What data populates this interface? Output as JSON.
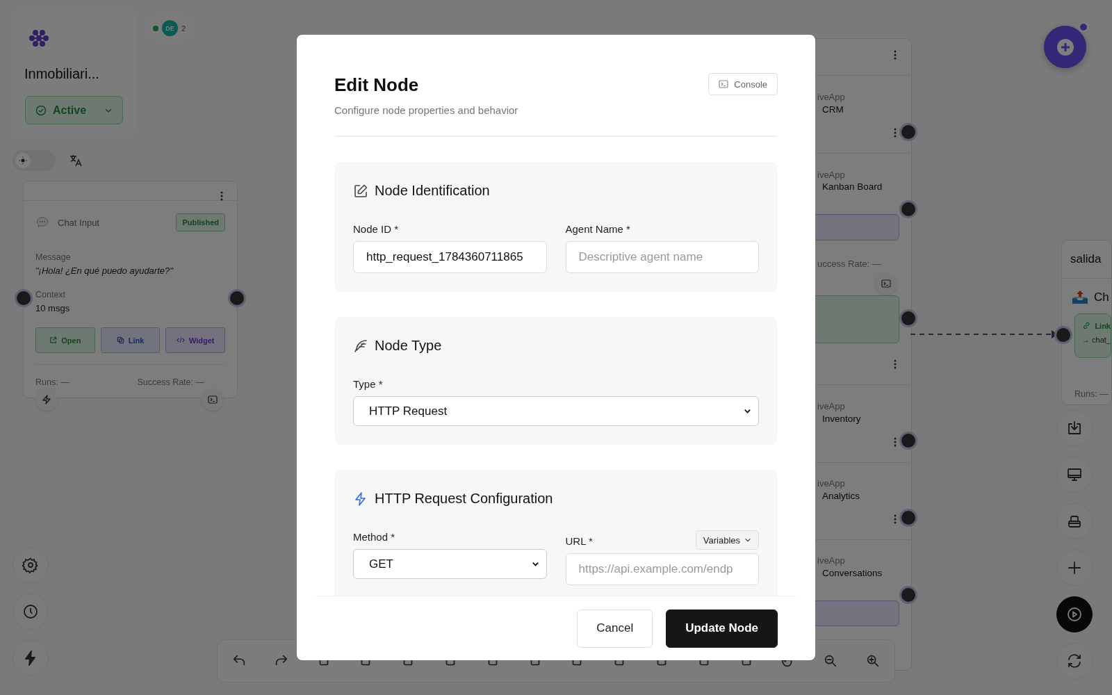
{
  "workspace": {
    "title": "Inmobiliari...",
    "status": "Active"
  },
  "presence": {
    "initials": "DE",
    "count": "2",
    "online": true
  },
  "theme": {
    "dark_mode": false
  },
  "chat_node": {
    "type_label": "Chat Input",
    "badge": "Published",
    "fields": [
      {
        "label": "Message",
        "value": "\"¡Hola! ¿En qué puedo ayudarte?\"",
        "kind": "quote"
      },
      {
        "label": "Context",
        "value": "10 msgs",
        "kind": "plain"
      }
    ],
    "actions": [
      {
        "label": "Open",
        "kind": "open"
      },
      {
        "label": "Link",
        "kind": "link"
      },
      {
        "label": "Widget",
        "kind": "widget"
      }
    ],
    "runs": "Runs: —",
    "success_rate": "Success Rate: —"
  },
  "app_nodes": [
    {
      "source": "iveApp",
      "name": "CRM"
    },
    {
      "source": "iveApp",
      "name": "Kanban Board"
    },
    {
      "source": "iveApp",
      "name": "Inventory"
    },
    {
      "source": "iveApp",
      "name": "Analytics"
    },
    {
      "source": "iveApp",
      "name": "Conversations"
    }
  ],
  "partial_success_rate": "uccess Rate: —",
  "output_node": {
    "title": "salida",
    "item": "Ch",
    "link": "Link",
    "target": "→ chat_",
    "runs": "Runs: —"
  },
  "modal": {
    "title": "Edit Node",
    "subtitle": "Configure node properties and behavior",
    "console": "Console",
    "sections": [
      {
        "kind": "identification",
        "title": "Node Identification",
        "fields": [
          {
            "label": "Node ID *",
            "value": "http_request_1784360711865"
          },
          {
            "label": "Agent Name *",
            "placeholder": "Descriptive agent name"
          }
        ]
      },
      {
        "kind": "type",
        "title": "Node Type",
        "fields": [
          {
            "label": "Type *",
            "value": "HTTP Request"
          }
        ]
      },
      {
        "kind": "http",
        "title": "HTTP Request Configuration",
        "fields": [
          {
            "label": "Method *",
            "value": "GET"
          },
          {
            "label": "URL *",
            "placeholder": "https://api.example.com/endp",
            "menu": "Variables"
          }
        ]
      }
    ],
    "buttons": [
      {
        "label": "Cancel",
        "kind": "secondary"
      },
      {
        "label": "Update Node",
        "kind": "primary"
      }
    ]
  }
}
